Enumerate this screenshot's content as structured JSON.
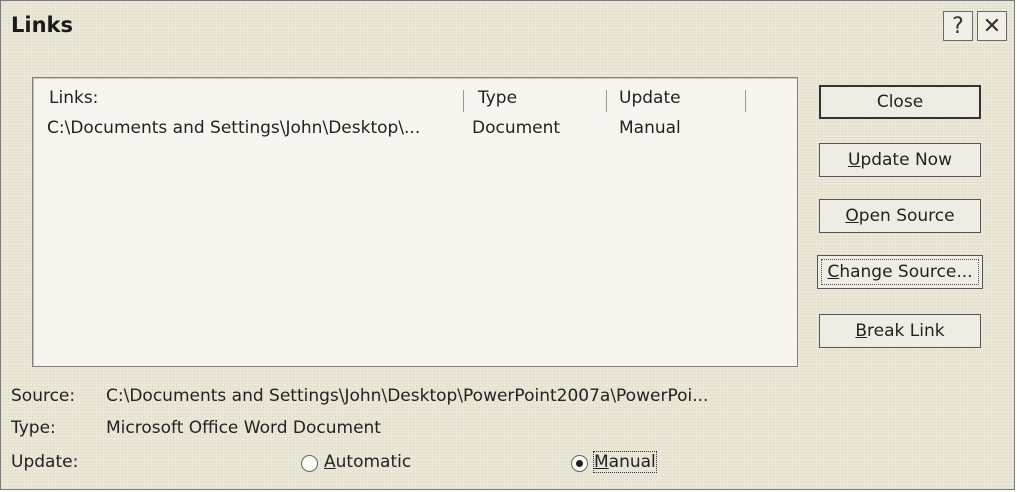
{
  "dialog": {
    "title": "Links",
    "help_glyph": "?",
    "close_glyph": "✕"
  },
  "list": {
    "columns": {
      "links": "Links:",
      "type": "Type",
      "update": "Update"
    },
    "rows": [
      {
        "links": "C:\\Documents and Settings\\John\\Desktop\\...",
        "type": "Document",
        "update": "Manual"
      }
    ]
  },
  "buttons": {
    "close": "Close",
    "update_now": {
      "pre": "",
      "key": "U",
      "post": "pdate Now"
    },
    "open_source": {
      "pre": "",
      "key": "O",
      "post": "pen Source"
    },
    "change_source": {
      "pre": "",
      "key": "C",
      "post": "hange Source..."
    },
    "break_link": {
      "pre": "",
      "key": "B",
      "post": "reak Link"
    }
  },
  "details": {
    "source_label": "Source:",
    "source_value": "C:\\Documents and Settings\\John\\Desktop\\PowerPoint2007a\\PowerPoi...",
    "type_label": "Type:",
    "type_value": "Microsoft Office Word Document",
    "update_label": "Update:",
    "automatic": {
      "key": "A",
      "post": "utomatic",
      "selected": false
    },
    "manual": {
      "key": "M",
      "post": "anual",
      "selected": true
    }
  }
}
